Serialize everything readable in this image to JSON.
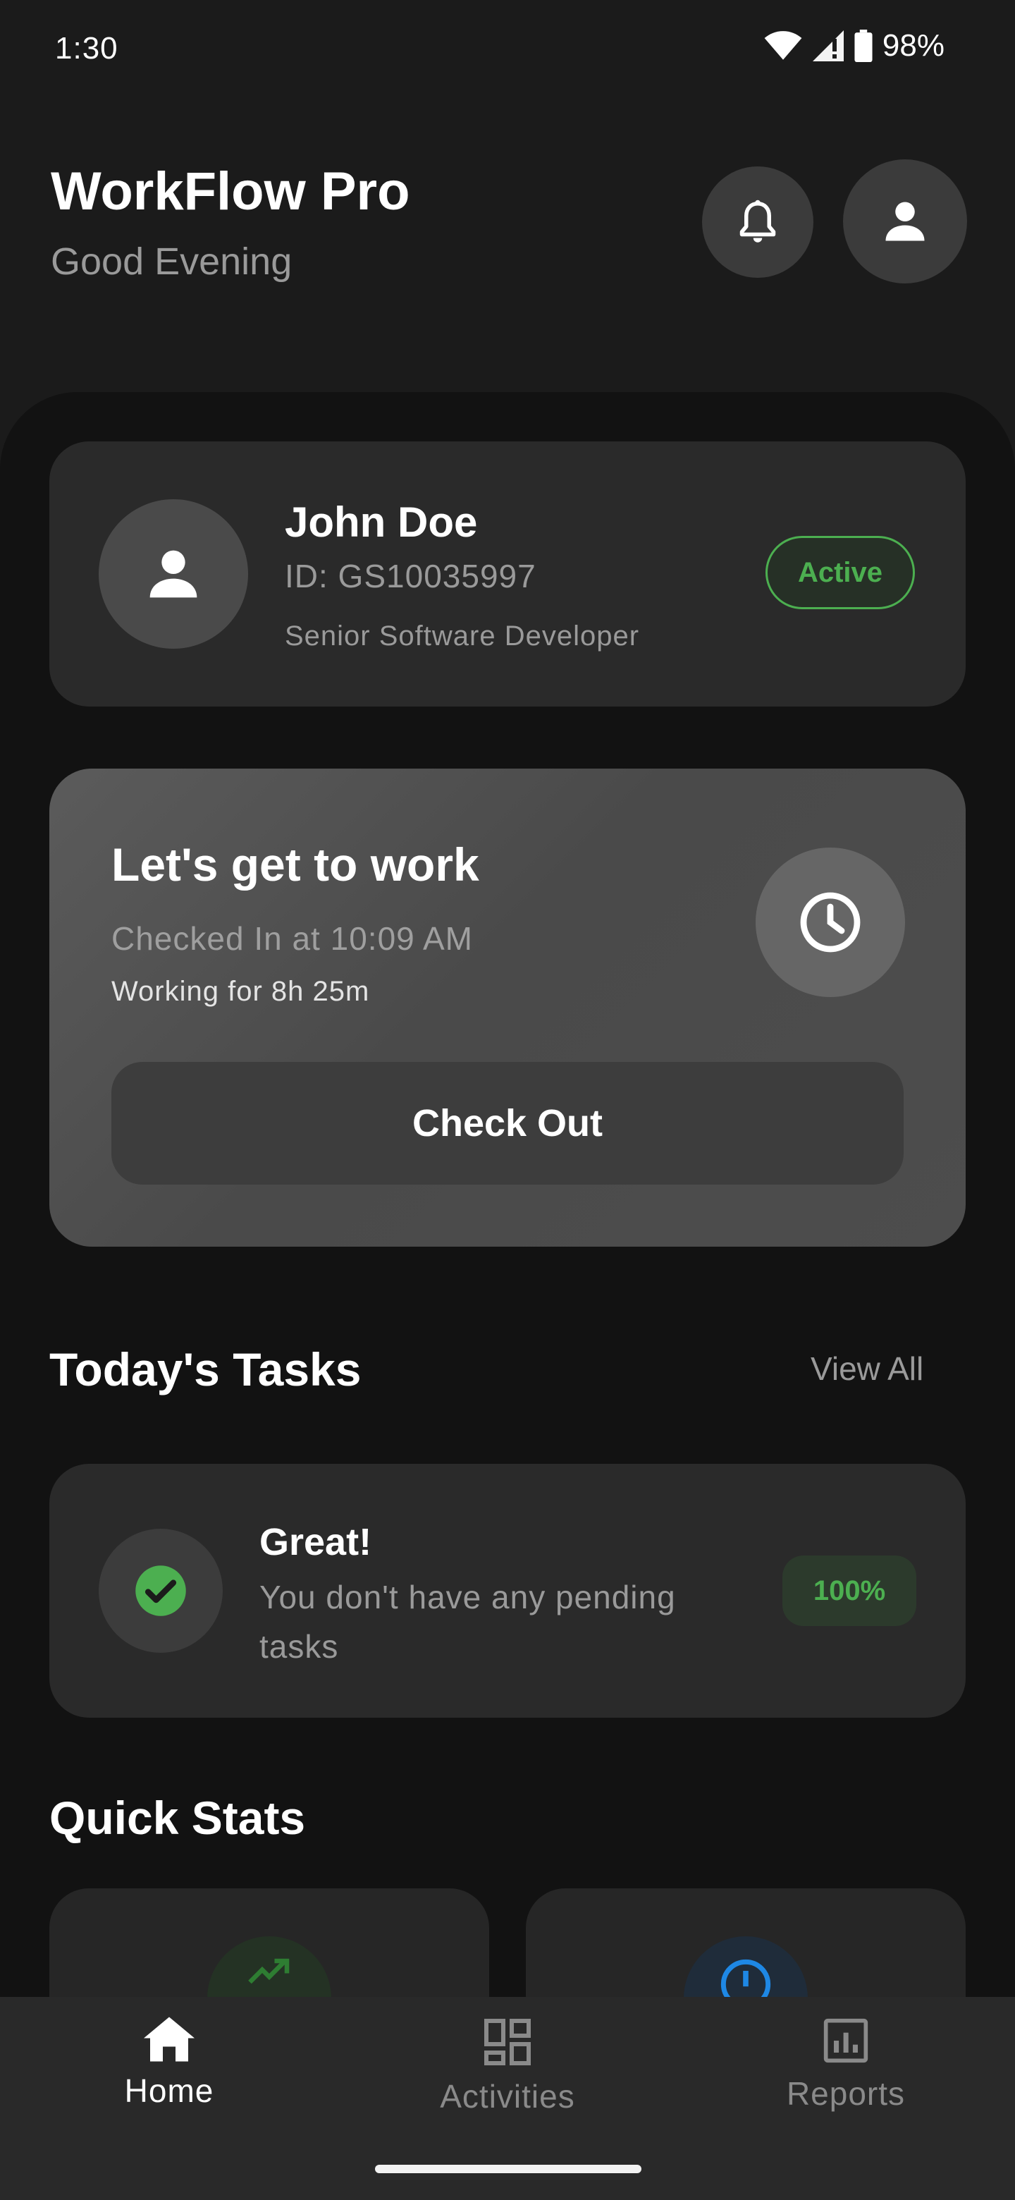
{
  "status_bar": {
    "time": "1:30",
    "battery": "98%",
    "icons": [
      "wifi-icon",
      "signal-icon",
      "battery-icon"
    ]
  },
  "header": {
    "title": "WorkFlow Pro",
    "greeting": "Good Evening",
    "icons": [
      "bell-icon",
      "person-icon"
    ]
  },
  "profile": {
    "name": "John Doe",
    "employee_id": "ID: GS10035997",
    "role": "Senior Software Developer",
    "status": "Active"
  },
  "work": {
    "title": "Let's get to work",
    "checked_in": "Checked In at 10:09 AM",
    "duration": "Working for 8h 25m",
    "button": "Check Out",
    "icon": "clock-icon"
  },
  "tasks": {
    "title": "Today's Tasks",
    "view_all": "View All",
    "heading": "Great!",
    "message": "You don't have any pending tasks",
    "progress": "100%",
    "icon": "check-circle-icon"
  },
  "stats": {
    "title": "Quick Stats",
    "icons": [
      "trending-up-icon",
      "info-icon"
    ]
  },
  "nav": [
    {
      "label": "Home",
      "icon": "home-icon",
      "active": true
    },
    {
      "label": "Activities",
      "icon": "grid-icon",
      "active": false
    },
    {
      "label": "Reports",
      "icon": "bar-chart-icon",
      "active": false
    }
  ],
  "colors": {
    "accent_green": "#4caf50",
    "accent_blue": "#2196f3",
    "background": "#121212",
    "card": "#2a2a2a"
  }
}
